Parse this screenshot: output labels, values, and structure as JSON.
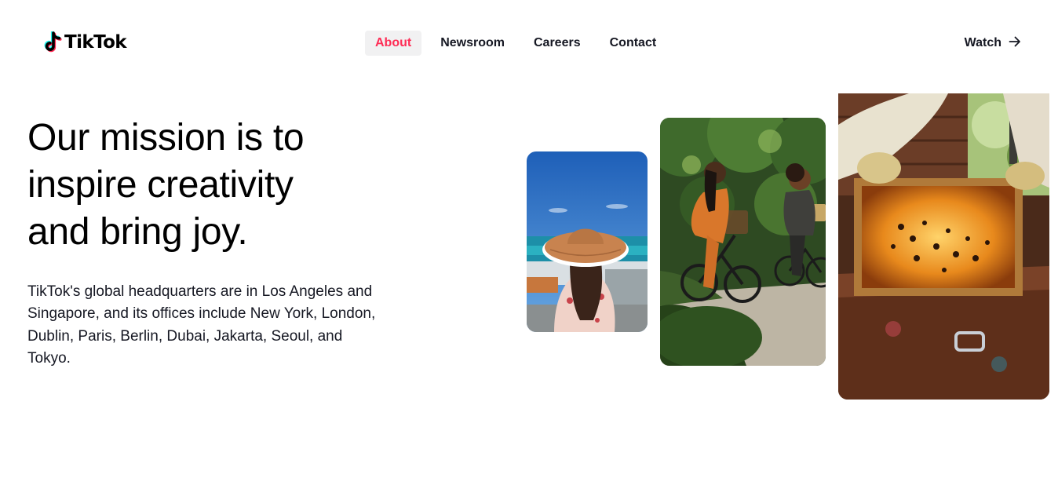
{
  "header": {
    "logo": {
      "text": "TikTok",
      "icon": "tiktok-note-icon"
    },
    "nav": [
      {
        "label": "About",
        "active": true
      },
      {
        "label": "Newsroom",
        "active": false
      },
      {
        "label": "Careers",
        "active": false
      },
      {
        "label": "Contact",
        "active": false
      }
    ],
    "watch": {
      "label": "Watch",
      "icon": "arrow-right-icon"
    }
  },
  "hero": {
    "headline": "Our mission is to inspire creativity and bring joy.",
    "description": "TikTok's global headquarters are in Los Angeles and Singapore, and its offices include New York, London, Dublin, Paris, Berlin, Dubai, Jakarta, Seoul, and Tokyo."
  },
  "photos": [
    {
      "subject": "woman in sun hat overlooking the sea"
    },
    {
      "subject": "two women riding bicycles on a park path"
    },
    {
      "subject": "beekeeper lifting a honeycomb frame from a hive"
    }
  ],
  "colors": {
    "accent": "#fe2c55",
    "text": "#161823",
    "nav_active_bg": "#f1f1f2",
    "logo_cyan": "#25f4ee"
  }
}
